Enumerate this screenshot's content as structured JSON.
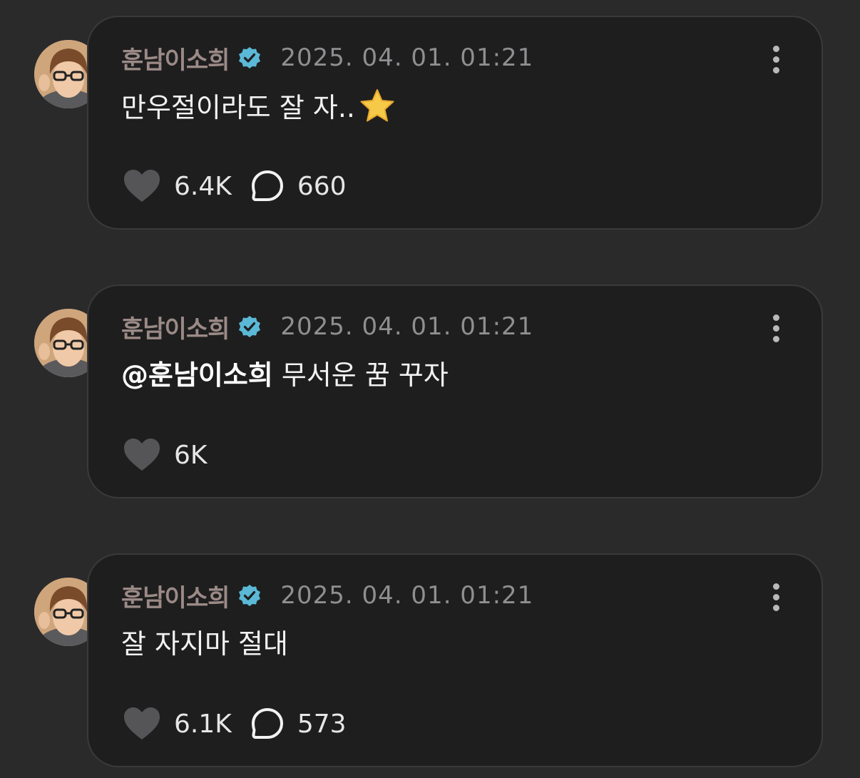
{
  "colors": {
    "background": "#2a2a2b",
    "card": "#1e1e1f",
    "username": "#9b8a86",
    "verified_badge": "#5bb8d6",
    "star": "#f7c948"
  },
  "posts": [
    {
      "username": "훈남이소희",
      "timestamp": "2025. 04. 01. 01:21",
      "text": "만우절이라도 잘 자..",
      "emoji": "star",
      "likes": "6.4K",
      "comments": "660"
    },
    {
      "username": "훈남이소희",
      "timestamp": "2025. 04. 01. 01:21",
      "mention": "@훈남이소희",
      "text": " 무서운 꿈 꾸자",
      "likes": "6K"
    },
    {
      "username": "훈남이소희",
      "timestamp": "2025. 04. 01. 01:21",
      "text": "잘 자지마 절대",
      "likes": "6.1K",
      "comments": "573"
    }
  ]
}
